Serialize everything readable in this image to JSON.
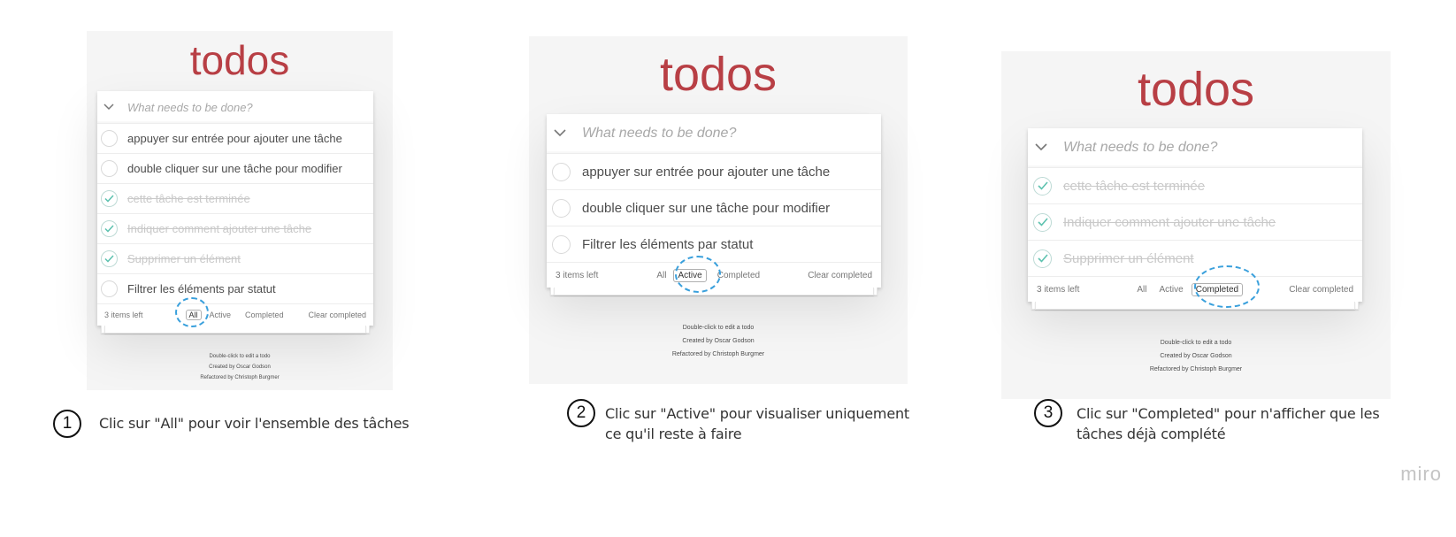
{
  "app": {
    "title": "todos",
    "placeholder": "What needs to be done?",
    "toggle_all_icon": "chevron-down-icon",
    "check_icon": "checkmark-icon"
  },
  "filters": {
    "all": "All",
    "active": "Active",
    "completed": "Completed",
    "clear": "Clear completed"
  },
  "info": {
    "line1": "Double-click to edit a todo",
    "line2": "Created by Oscar Godson",
    "line3": "Refactored by Christoph Burgmer"
  },
  "colors": {
    "title": "#b83f45",
    "highlight": "#3aa0dc",
    "checkmark": "#5dc2af"
  },
  "panels": [
    {
      "count_label": "3 items left",
      "selected_filter": "All",
      "todos": [
        {
          "text": "appuyer sur entrée pour ajouter une tâche",
          "completed": false
        },
        {
          "text": "double cliquer sur une tâche pour modifier",
          "completed": false
        },
        {
          "text": "cette tâche est terminée",
          "completed": true
        },
        {
          "text": "Indiquer comment ajouter une tâche",
          "completed": true
        },
        {
          "text": "Supprimer un élément",
          "completed": true
        },
        {
          "text": "Filtrer les éléments par statut",
          "completed": false
        }
      ],
      "step_number": "1",
      "step_text": "Clic sur \"All\" pour voir l'ensemble des tâches"
    },
    {
      "count_label": "3 items left",
      "selected_filter": "Active",
      "todos": [
        {
          "text": "appuyer sur entrée pour ajouter une tâche",
          "completed": false
        },
        {
          "text": "double cliquer sur une tâche pour modifier",
          "completed": false
        },
        {
          "text": "Filtrer les éléments par statut",
          "completed": false
        }
      ],
      "step_number": "2",
      "step_text_line1": "Clic sur \"Active\" pour visualiser uniquement",
      "step_text_line2": "ce qu'il reste à faire"
    },
    {
      "count_label": "3 items left",
      "selected_filter": "Completed",
      "todos": [
        {
          "text": "cette tâche est terminée",
          "completed": true
        },
        {
          "text": "Indiquer comment ajouter une tâche",
          "completed": true
        },
        {
          "text": "Supprimer un élément",
          "completed": true
        }
      ],
      "step_number": "3",
      "step_text_line1": "Clic sur \"Completed\" pour n'afficher que les",
      "step_text_line2": "tâches déjà complété"
    }
  ],
  "watermark": "miro"
}
